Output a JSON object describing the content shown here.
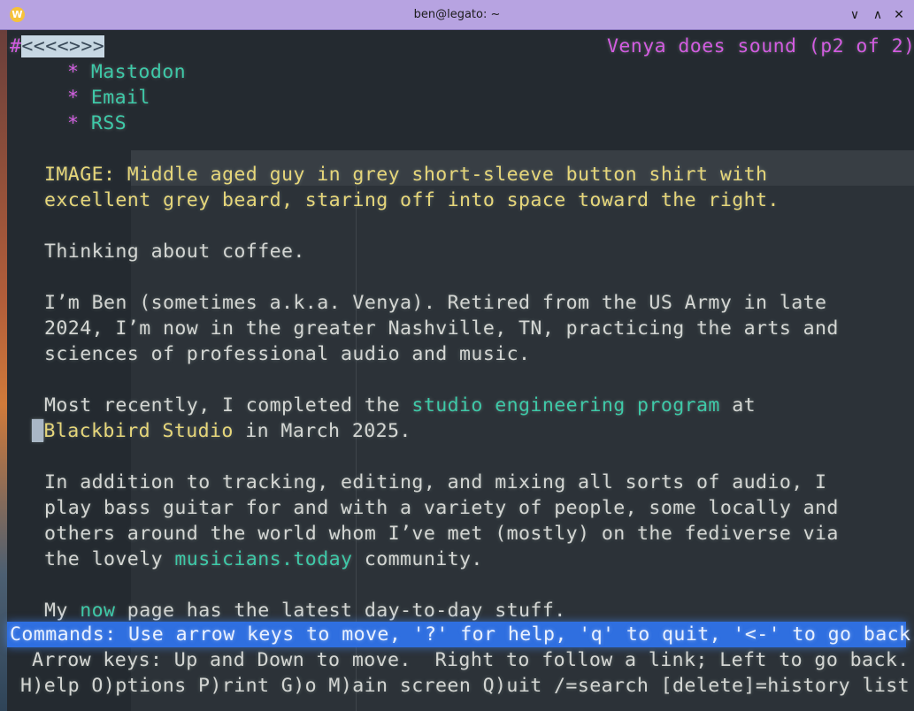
{
  "window": {
    "app_icon_letter": "W",
    "title": "ben@legato: ~",
    "btn_min": "∨",
    "btn_max": "∧",
    "btn_close": "✕"
  },
  "terminal": {
    "top_left_marker": "#",
    "top_left_arrows": "<<<<>>>",
    "page_title": "Venya does sound (p2 of 2)",
    "bullet": "*",
    "links_list": [
      "Mastodon",
      "Email",
      "RSS"
    ],
    "image_alt_line1": "IMAGE: Middle aged guy in grey short-sleeve button shirt with",
    "image_alt_line2": "excellent grey beard, staring off into space toward the right.",
    "para_coffee": "Thinking about coffee.",
    "para_bio_line1": "I’m Ben (sometimes a.k.a. Venya). Retired from the US Army in late",
    "para_bio_line2": "2024, I’m now in the greater Nashville, TN, practicing the arts and",
    "para_bio_line3": "sciences of professional audio and music.",
    "para_recent_pre": "Most recently, I completed the ",
    "para_recent_link": "studio engineering program",
    "para_recent_post": " at",
    "para_recent_line2_link": "Blackbird Studio",
    "para_recent_line2_post": " in March 2025.",
    "para_work_line1": "In addition to tracking, editing, and mixing all sorts of audio, I",
    "para_work_line2": "play bass guitar for and with a variety of people, some locally and",
    "para_work_line3": "others around the world whom I’ve met (mostly) on the fediverse via",
    "para_work_line4_pre": "the lovely ",
    "para_work_line4_link": "musicians.today",
    "para_work_line4_post": " community.",
    "para_now_pre": "My ",
    "para_now_link": "now",
    "para_now_post": " page has the latest day-to-day stuff.",
    "status_line": "Commands: Use arrow keys to move, '?' for help, 'q' to quit, '<-' to go back.",
    "help_line1": "Arrow keys: Up and Down to move.  Right to follow a link; Left to go back.",
    "help_line2": "H)elp O)ptions P)rint G)o M)ain screen Q)uit /=search [delete]=history list"
  },
  "colors": {
    "title_bar": "#b7a3e1",
    "text": "#d4d6d3",
    "link": "#3ec9a8",
    "highlight_link": "#e6d67a",
    "heading": "#d25ce0",
    "status_bar": "#2f6fe0"
  }
}
